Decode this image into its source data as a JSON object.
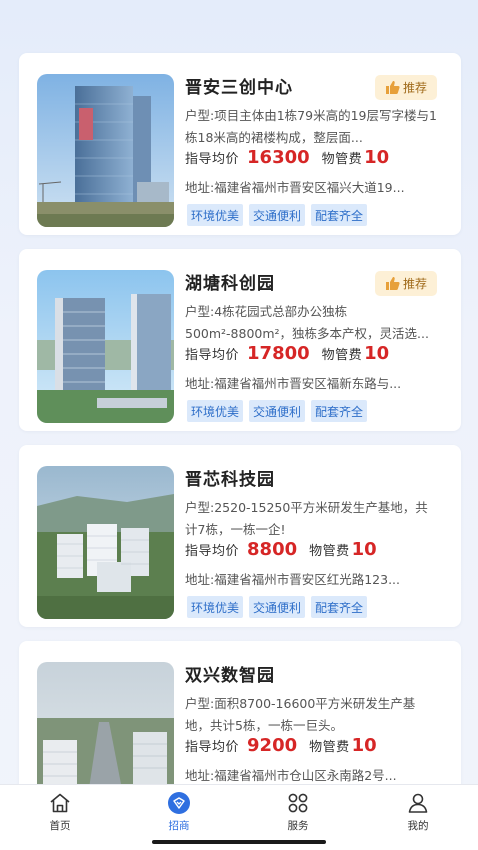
{
  "properties": [
    {
      "name": "晋安三创中心",
      "badge": "推荐",
      "desc": "户型:项目主体由1栋79米高的19层写字楼与1栋18米高的裙楼构成，整层面...",
      "price_label": "指导均价",
      "price": "16300",
      "fee_label": "物管费",
      "fee": "10",
      "address": "地址:福建省福州市晋安区福兴大道19...",
      "tags": [
        "环境优美",
        "交通便利",
        "配套齐全"
      ]
    },
    {
      "name": "湖塘科创园",
      "badge": "推荐",
      "desc": "户型:4栋花园式总部办公独栋500m²-8800m²，独栋多本产权，灵活选...",
      "price_label": "指导均价",
      "price": "17800",
      "fee_label": "物管费",
      "fee": "10",
      "address": "地址:福建省福州市晋安区福新东路与...",
      "tags": [
        "环境优美",
        "交通便利",
        "配套齐全"
      ]
    },
    {
      "name": "晋芯科技园",
      "desc": "户型:2520-15250平方米研发生产基地，共计7栋，一栋一企!",
      "price_label": "指导均价",
      "price": "8800",
      "fee_label": "物管费",
      "fee": "10",
      "address": "地址:福建省福州市晋安区红光路123...",
      "tags": [
        "环境优美",
        "交通便利",
        "配套齐全"
      ]
    },
    {
      "name": "双兴数智园",
      "desc": "户型:面积8700-16600平方米研发生产基地，共计5栋，一栋一巨头。",
      "price_label": "指导均价",
      "price": "9200",
      "fee_label": "物管费",
      "fee": "10",
      "address": "地址:福建省福州市仓山区永南路2号...",
      "tags": []
    }
  ],
  "tabbar": {
    "items": [
      {
        "label": "首页",
        "icon": "home-icon",
        "active": false
      },
      {
        "label": "招商",
        "icon": "investment-icon",
        "active": true
      },
      {
        "label": "服务",
        "icon": "grid-icon",
        "active": false
      },
      {
        "label": "我的",
        "icon": "user-icon",
        "active": false
      }
    ]
  },
  "colors": {
    "accent": "#2f6fe0",
    "price": "#d62626",
    "tag_bg": "#dbe9fb",
    "tag_text": "#2f6fc9",
    "badge_bg": "#fdf0d6"
  }
}
